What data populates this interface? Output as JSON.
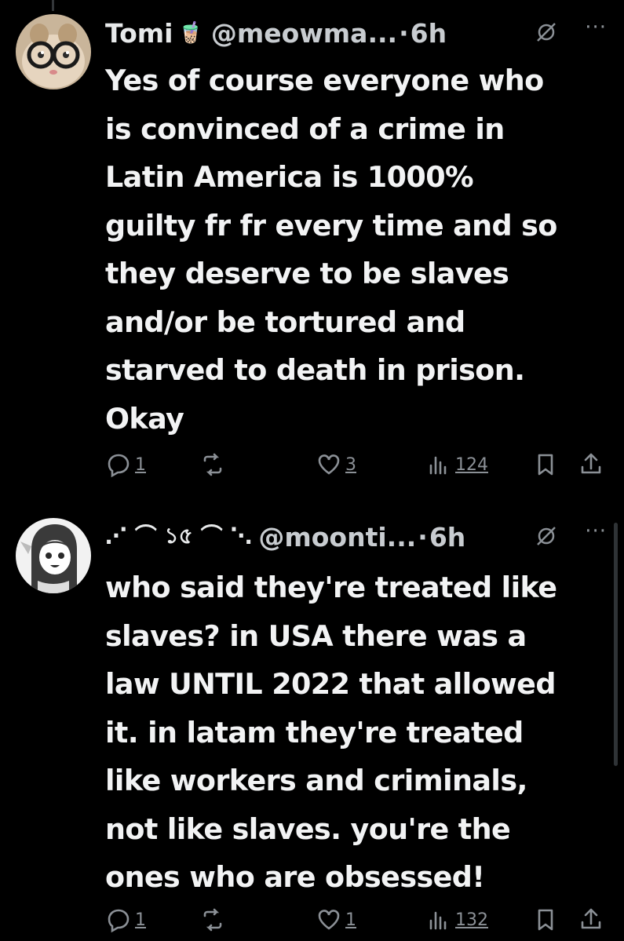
{
  "tweets": [
    {
      "name": "Tomi",
      "name_emoji": "🧋",
      "handle": "@meowma...",
      "separator": "·",
      "time": "6h",
      "text": "Yes of course everyone who\nis convinced of a crime in\nLatin America is 1000%\nguilty fr fr every time and so\nthey deserve to be slaves\nand/or be tortured and\nstarved to death in prison.\nOkay",
      "replies": "1",
      "likes": "3",
      "views": "124"
    },
    {
      "name_deco": "⋰ ⌒ ১৫ ⌒ ⋱",
      "handle": "@moonti...",
      "separator": "·",
      "time": "6h",
      "text": "who said they're treated like\nslaves? in USA there was a\nlaw UNTIL 2022 that allowed\nit. in latam they're treated\nlike workers and criminals,\nnot like slaves. you're the\nones who are obsessed!",
      "replies": "1",
      "likes": "1",
      "views": "132"
    }
  ],
  "icons": {
    "reply": "reply-icon",
    "retweet": "retweet-icon",
    "like": "heart-icon",
    "views": "views-icon",
    "bookmark": "bookmark-icon",
    "share": "share-icon",
    "grok": "grok-icon",
    "more": "more-icon"
  },
  "colors": {
    "background": "#000000",
    "text": "#e7e9ea",
    "muted": "#8b9096"
  }
}
